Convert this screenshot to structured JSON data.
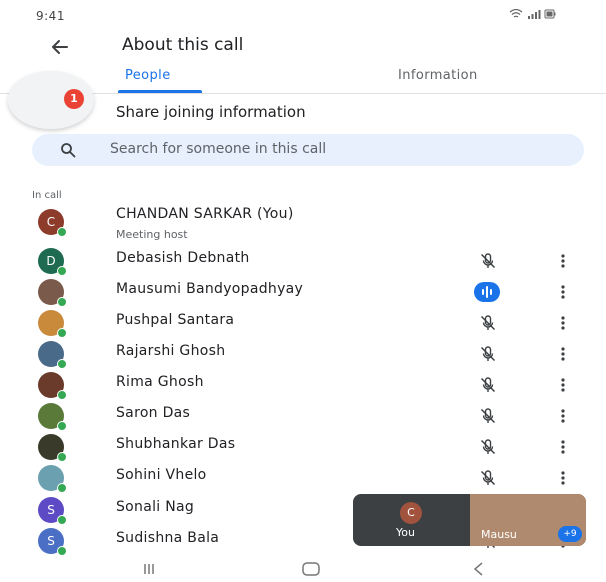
{
  "status_bar": {
    "time": "9:41"
  },
  "header": {
    "title": "About this call"
  },
  "tabs": [
    {
      "label": "People"
    },
    {
      "label": "Information"
    }
  ],
  "share": {
    "label": "Share joining information",
    "badge_count": "1"
  },
  "search": {
    "placeholder": "Search for someone in this call"
  },
  "section": {
    "label": "In call"
  },
  "participants": [
    {
      "name": "CHANDAN SARKAR (You)",
      "subtitle": "Meeting host",
      "initial": "C",
      "avatar_color": "#8d3b2a",
      "status": "host"
    },
    {
      "name": "Debasish Debnath",
      "initial": "D",
      "avatar_color": "#1e6b52",
      "status": "muted"
    },
    {
      "name": "Mausumi Bandyopadhyay",
      "initial": "",
      "avatar_color": "#7a5a4a",
      "status": "speaking"
    },
    {
      "name": "Pushpal Santara",
      "initial": "",
      "avatar_color": "#c98a3c",
      "status": "muted"
    },
    {
      "name": "Rajarshi Ghosh",
      "initial": "",
      "avatar_color": "#4a6a8a",
      "status": "muted"
    },
    {
      "name": "Rima Ghosh",
      "initial": "",
      "avatar_color": "#6a3a2a",
      "status": "muted"
    },
    {
      "name": "Saron Das",
      "initial": "",
      "avatar_color": "#5a7a3a",
      "status": "muted"
    },
    {
      "name": "Shubhankar Das",
      "initial": "",
      "avatar_color": "#3a3a2a",
      "status": "muted"
    },
    {
      "name": "Sohini Vhelo",
      "initial": "",
      "avatar_color": "#6aa0b0",
      "status": "muted"
    },
    {
      "name": "Sonali Nag",
      "initial": "S",
      "avatar_color": "#5c4bc4",
      "status": "muted"
    },
    {
      "name": "Sudishna Bala",
      "initial": "S",
      "avatar_color": "#4a6fc4",
      "status": "muted"
    }
  ],
  "self_view": {
    "initial": "C",
    "label": "You",
    "speaker_label": "Mausu",
    "extra_count": "+9"
  },
  "colors": {
    "accent": "#1a73e8",
    "badge": "#ea4335",
    "presence": "#34a853"
  }
}
